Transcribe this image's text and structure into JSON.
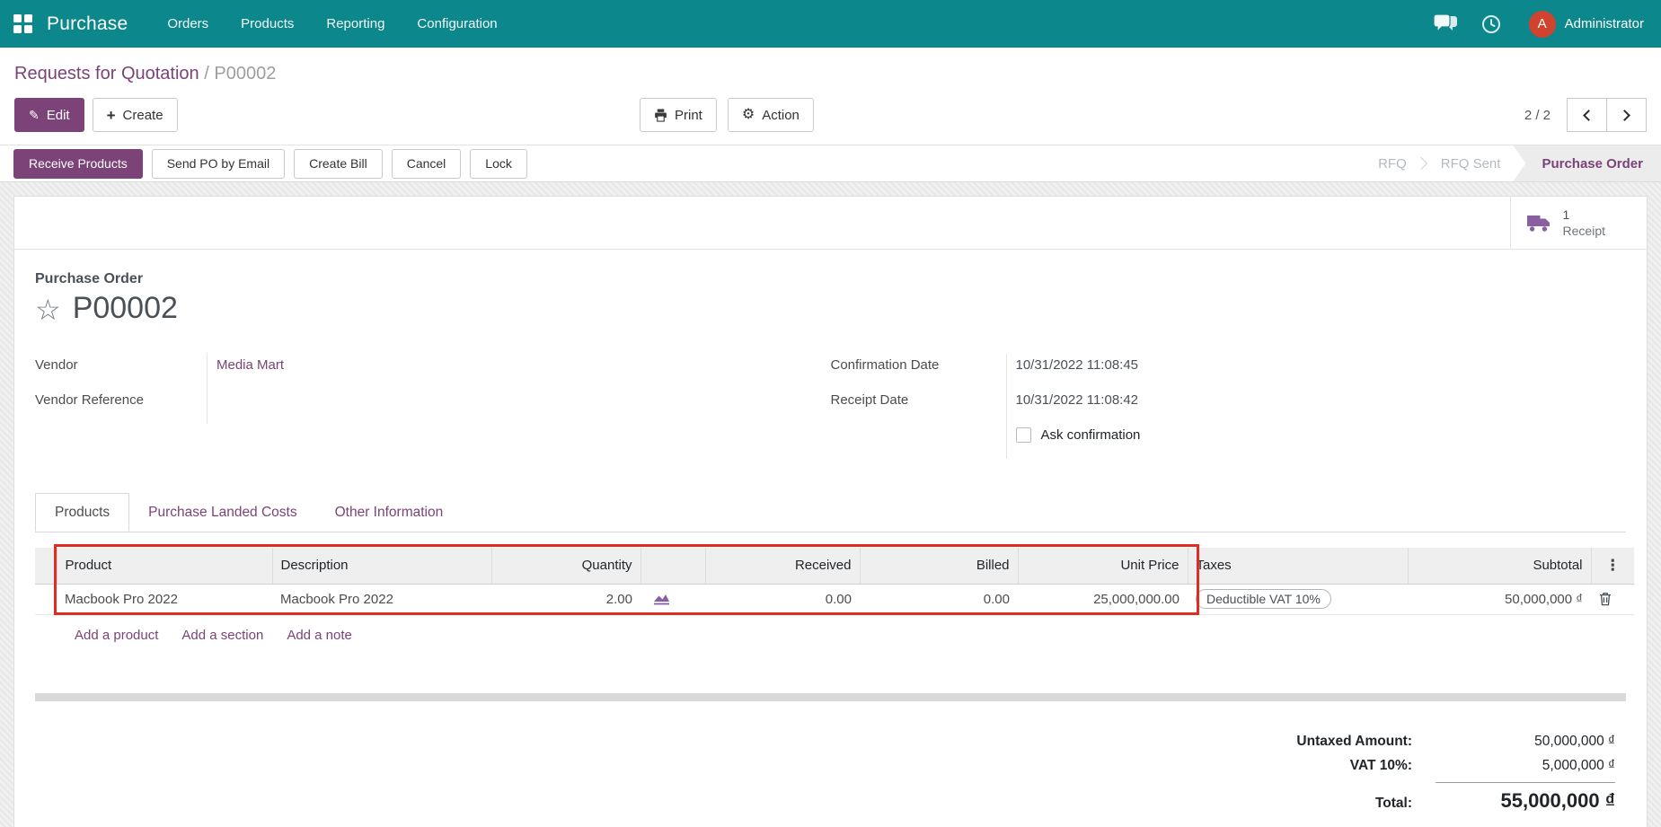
{
  "colors": {
    "navbar": "#0c878c",
    "primary": "#7b4377",
    "icon-violet": "#8a5fa0",
    "annotation": "#e02d21",
    "avatar": "#d0432e"
  },
  "navbar": {
    "brand": "Purchase",
    "menus": [
      "Orders",
      "Products",
      "Reporting",
      "Configuration"
    ],
    "user": {
      "initial": "A",
      "name": "Administrator"
    }
  },
  "breadcrumb": {
    "parent": "Requests for Quotation",
    "separator": "/",
    "current": "P00002"
  },
  "control_panel": {
    "edit": "Edit",
    "create": "Create",
    "print": "Print",
    "action": "Action",
    "pager": "2 / 2"
  },
  "statusbar": {
    "receive_products": "Receive Products",
    "send_po": "Send PO by Email",
    "create_bill": "Create Bill",
    "cancel": "Cancel",
    "lock": "Lock",
    "steps": [
      {
        "label": "RFQ"
      },
      {
        "label": "RFQ Sent"
      },
      {
        "label": "Purchase Order"
      }
    ]
  },
  "sheet": {
    "receipt_button": {
      "count": "1",
      "label": "Receipt"
    },
    "doc_type": "Purchase Order",
    "doc_name": "P00002",
    "fields": {
      "vendor_label": "Vendor",
      "vendor_value": "Media Mart",
      "vendor_ref_label": "Vendor Reference",
      "confirmation_date_label": "Confirmation Date",
      "confirmation_date_value": "10/31/2022 11:08:45",
      "receipt_date_label": "Receipt Date",
      "receipt_date_value": "10/31/2022 11:08:42",
      "ask_confirmation_label": "Ask confirmation"
    },
    "tabs": [
      "Products",
      "Purchase Landed Costs",
      "Other Information"
    ],
    "table": {
      "headers": {
        "product": "Product",
        "description": "Description",
        "quantity": "Quantity",
        "received": "Received",
        "billed": "Billed",
        "unit_price": "Unit Price",
        "taxes": "Taxes",
        "subtotal": "Subtotal"
      },
      "rows": [
        {
          "product": "Macbook Pro 2022",
          "description": "Macbook Pro 2022",
          "quantity": "2.00",
          "received": "0.00",
          "billed": "0.00",
          "unit_price": "25,000,000.00",
          "taxes": "Deductible VAT 10%",
          "subtotal": "50,000,000 ₫"
        }
      ],
      "links": [
        "Add a product",
        "Add a section",
        "Add a note"
      ]
    },
    "totals": {
      "untaxed_label": "Untaxed Amount:",
      "untaxed_value": "50,000,000 ₫",
      "vat_label": "VAT 10%:",
      "vat_value": "5,000,000 ₫",
      "total_label": "Total:",
      "total_value": "55,000,000 ₫"
    }
  }
}
